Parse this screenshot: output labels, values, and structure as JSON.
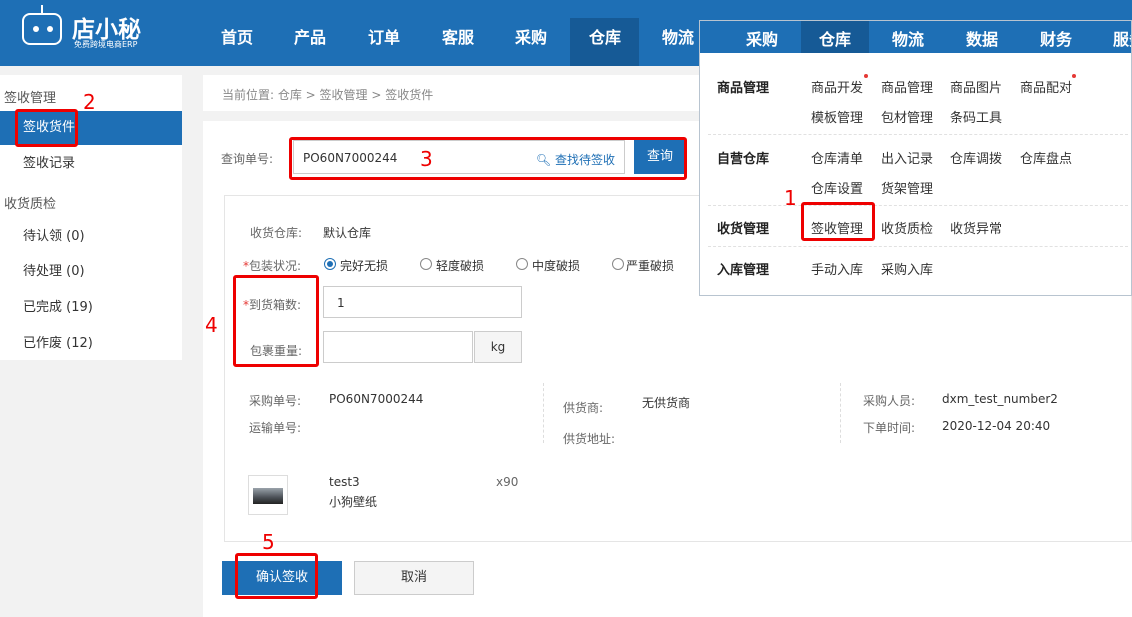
{
  "app": {
    "logo_text": "店小秘",
    "logo_slogan": "免费跨境电商ERP"
  },
  "topnav": {
    "items": [
      "首页",
      "产品",
      "订单",
      "客服",
      "采购",
      "仓库",
      "物流"
    ],
    "active": "仓库"
  },
  "dropdown": {
    "nav_items": [
      "采购",
      "仓库",
      "物流",
      "数据",
      "财务",
      "服务"
    ],
    "active": "仓库",
    "groups": [
      {
        "category": "商品管理",
        "links": [
          "商品开发",
          "商品管理",
          "商品图片",
          "商品配对",
          "模板管理",
          "包材管理",
          "条码工具"
        ]
      },
      {
        "category": "自营仓库",
        "links": [
          "仓库清单",
          "出入记录",
          "仓库调拨",
          "仓库盘点",
          "仓库设置",
          "货架管理"
        ]
      },
      {
        "category": "收货管理",
        "links": [
          "签收管理",
          "收货质检",
          "收货异常"
        ]
      },
      {
        "category": "入库管理",
        "links": [
          "手动入库",
          "采购入库"
        ]
      }
    ]
  },
  "sidebar": {
    "group1": "签收管理",
    "group1_items": [
      "签收货件",
      "签收记录"
    ],
    "group2": "收货质检",
    "group2_items": [
      "待认领 (0)",
      "待处理 (0)",
      "已完成 (19)",
      "已作废 (12)"
    ],
    "active": "签收货件"
  },
  "breadcrumb": "当前位置:  仓库 > 签收管理 > 签收货件",
  "query": {
    "label": "查询单号:",
    "value": "PO60N7000244",
    "find_link": "查找待签收",
    "button": "查询"
  },
  "receive": {
    "warehouse_label": "收货仓库:",
    "warehouse_value": "默认仓库",
    "package_label": "包装状况:",
    "package_options": [
      "完好无损",
      "轻度破损",
      "中度破损",
      "严重破损"
    ],
    "package_selected": "完好无损",
    "boxes_label": "到货箱数:",
    "boxes_value": "1",
    "weight_label": "包裹重量:",
    "weight_value": "",
    "weight_unit": "kg"
  },
  "order": {
    "po_label": "采购单号:",
    "po_value": "PO60N7000244",
    "tracking_label": "运输单号:",
    "supplier_label": "供货商:",
    "supplier_value": "无供货商",
    "supplier_addr_label": "供货地址:",
    "buyer_label": "采购人员:",
    "buyer_value": "dxm_test_number2",
    "order_time_label": "下单时间:",
    "order_time_value": "2020-12-04 20:40"
  },
  "product": {
    "sku": "test3",
    "name": "小狗壁纸",
    "quantity": "x90"
  },
  "actions": {
    "confirm": "确认签收",
    "cancel": "取消"
  },
  "annotations": [
    "1",
    "2",
    "3",
    "4",
    "5"
  ],
  "colors": {
    "primary": "#1e6fb5",
    "primary_dark": "#165a96",
    "annotation_red": "#e00000"
  }
}
